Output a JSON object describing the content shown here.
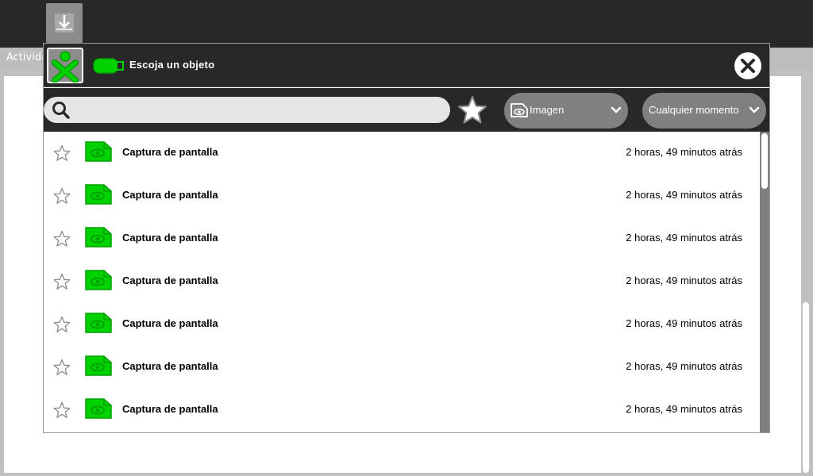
{
  "background": {
    "tab_label": "Activida",
    "download_icon": "download-arrow-icon"
  },
  "dialog": {
    "title": "Escoja un objeto",
    "source_icon": "usb-stick-icon",
    "close_icon": "close-icon"
  },
  "toolbar": {
    "search_placeholder": "",
    "search_value": "",
    "favorite_icon": "star-icon",
    "type_filter": {
      "label": "Imagen",
      "icon": "image-file-icon"
    },
    "date_filter": {
      "label": "Cualquier momento"
    }
  },
  "entries": [
    {
      "title": "Captura de pantalla",
      "date": "2 horas, 49 minutos atrás",
      "starred": false
    },
    {
      "title": "Captura de pantalla",
      "date": "2 horas, 49 minutos atrás",
      "starred": false
    },
    {
      "title": "Captura de pantalla",
      "date": "2 horas, 49 minutos atrás",
      "starred": false
    },
    {
      "title": "Captura de pantalla",
      "date": "2 horas, 49 minutos atrás",
      "starred": false
    },
    {
      "title": "Captura de pantalla",
      "date": "2 horas, 49 minutos atrás",
      "starred": false
    },
    {
      "title": "Captura de pantalla",
      "date": "2 horas, 49 minutos atrás",
      "starred": false
    },
    {
      "title": "Captura de pantalla",
      "date": "2 horas, 49 minutos atrás",
      "starred": false
    }
  ],
  "colors": {
    "toolbar_bg": "#282828",
    "accent_green": "#00d200",
    "icon_stroke": "#00a000",
    "combo_bg": "#808080"
  }
}
